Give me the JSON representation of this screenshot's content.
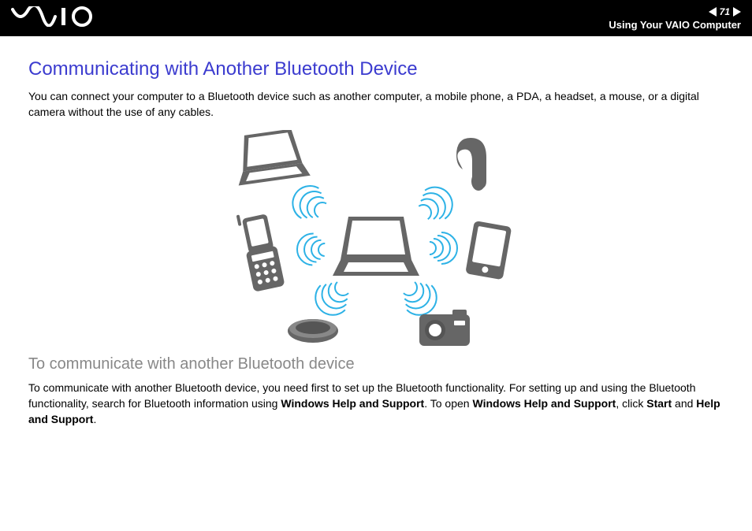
{
  "header": {
    "page_number": "71",
    "section": "Using Your VAIO Computer",
    "brand": "VAIO"
  },
  "main": {
    "heading": "Communicating with Another Bluetooth Device",
    "intro": "You can connect your computer to a Bluetooth device such as another computer, a mobile phone, a PDA, a headset, a mouse, or a digital camera without the use of any cables.",
    "subheading": "To communicate with another Bluetooth device",
    "body_parts": [
      "To communicate with another Bluetooth device, you need first to set up the Bluetooth functionality. For setting up and using the Bluetooth functionality, search for Bluetooth information using ",
      "Windows Help and Support",
      ". To open ",
      "Windows Help and Support",
      ", click ",
      "Start",
      " and ",
      "Help and Support",
      "."
    ]
  }
}
